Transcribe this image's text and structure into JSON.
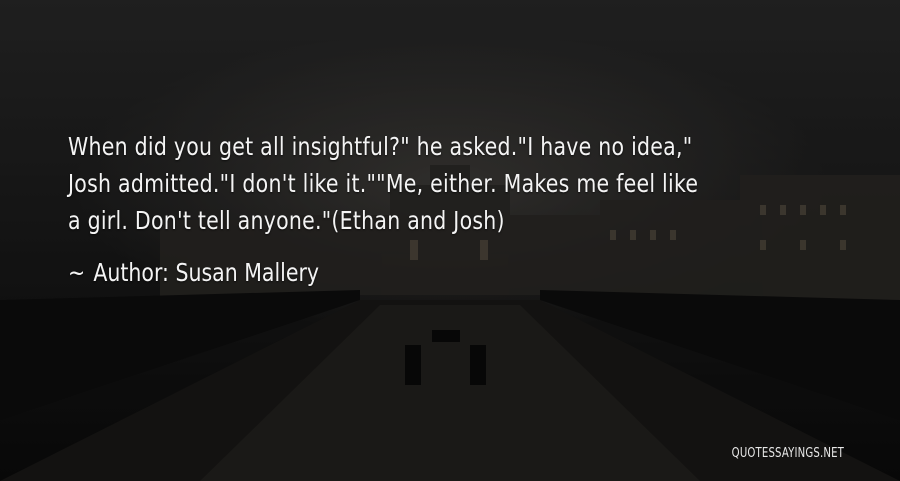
{
  "quote": {
    "text": "When did you get all insightful?\" he asked.\"I have no idea,\" Josh admitted.\"I don't like it.\"\"Me, either. Makes me feel like a girl. Don't tell anyone.\"(Ethan and Josh)"
  },
  "author": {
    "prefix_icon": "tilde-icon",
    "prefix_glyph": "~",
    "label": "Author:",
    "name": "Susan Mallery"
  },
  "watermark": {
    "text": "QUOTESSAYINGS.NET"
  }
}
